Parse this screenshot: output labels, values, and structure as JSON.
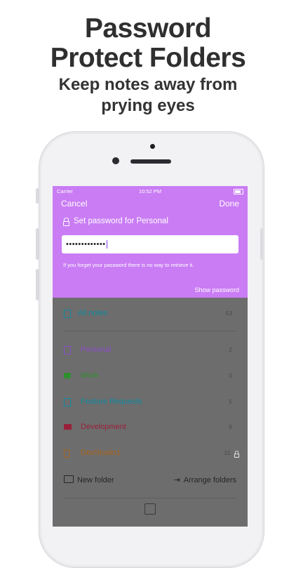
{
  "headline": {
    "title_line1": "Password",
    "title_line2": "Protect Folders",
    "subtitle_line1": "Keep notes away from",
    "subtitle_line2": "prying eyes"
  },
  "status": {
    "carrier": "Carrier",
    "time": "10:52 PM"
  },
  "sheet": {
    "cancel": "Cancel",
    "done": "Done",
    "title": "Set password for Personal",
    "password_value": "•••••••••••••",
    "hint": "If you forget your password there is no way to retrieve it.",
    "show_password": "Show password",
    "accent_color": "#c97cf4"
  },
  "list": {
    "all_notes": {
      "label": "All notes",
      "count": "53",
      "color": "#0e8aa0"
    },
    "folders": [
      {
        "label": "Personal",
        "count": "2",
        "color": "#8a4dc8",
        "icon": "note-icon"
      },
      {
        "label": "Work",
        "count": "0",
        "color": "#2f8f2f",
        "icon": "briefcase-icon"
      },
      {
        "label": "Feature Requests",
        "count": "5",
        "color": "#0e8aa0",
        "icon": "document-icon"
      },
      {
        "label": "Development",
        "count": "8",
        "color": "#9a1f3a",
        "icon": "monitor-icon"
      },
      {
        "label": "DevStudio1",
        "count": "31",
        "color": "#a9651b",
        "icon": "phone-icon"
      }
    ]
  },
  "footer": {
    "new_folder": "New folder",
    "arrange_folders": "Arrange folders"
  }
}
